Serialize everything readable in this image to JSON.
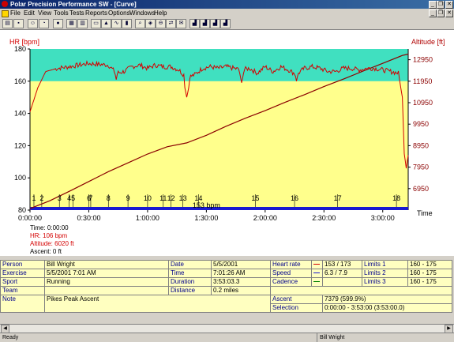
{
  "window": {
    "title": "Polar Precision Performance SW - [Curve]"
  },
  "menu": [
    "File",
    "Edit",
    "View",
    "Tools",
    "Tests",
    "Reports",
    "Options",
    "Windows",
    "Help"
  ],
  "chart_data": {
    "type": "line",
    "left_axis_label": "HR [bpm]",
    "right_axis_label": "Altitude [ft]",
    "x_axis_label": "Time",
    "hr_ticks": [
      "180",
      "160",
      "140",
      "120",
      "100",
      "80"
    ],
    "hr_ylim": [
      80,
      180
    ],
    "alt_ticks": [
      "12950",
      "11950",
      "10950",
      "9950",
      "8950",
      "7950",
      "6950"
    ],
    "alt_ylim": [
      5950,
      13450
    ],
    "time_ticks": [
      "0:00:00",
      "0:30:00",
      "1:00:00",
      "1:30:00",
      "2:00:00",
      "2:30:00",
      "3:00:00"
    ],
    "time_tick_seconds": [
      0,
      1800,
      3600,
      5400,
      7200,
      9000,
      10800
    ],
    "xlim_seconds": [
      0,
      11580
    ],
    "limits_band_bpm": [
      160,
      175
    ],
    "hr_series": {
      "name": "Heart rate",
      "color": "#d40000",
      "x_min": [
        0,
        4,
        8,
        14,
        20,
        30,
        40,
        44,
        48,
        52,
        56,
        60,
        64,
        68,
        72,
        76,
        80,
        84,
        88,
        92,
        96,
        100,
        104,
        108,
        112,
        116,
        120,
        124,
        128,
        132,
        136,
        140,
        144,
        148,
        152,
        156,
        160,
        164,
        168,
        172,
        176,
        180,
        184,
        188,
        190,
        191,
        192,
        193
      ],
      "bpm": [
        141,
        156,
        166,
        168,
        169,
        171,
        170,
        165,
        166,
        169,
        170,
        168,
        170,
        169,
        169,
        167,
        162,
        164,
        168,
        169,
        168,
        169,
        168,
        167,
        168,
        165,
        169,
        166,
        169,
        167,
        164,
        168,
        169,
        168,
        166,
        166,
        168,
        168,
        167,
        168,
        168,
        167,
        166,
        165,
        150,
        115,
        106,
        114
      ]
    },
    "dips": [
      {
        "x_min": 44,
        "bpm": 161
      },
      {
        "x_min": 80,
        "bpm": 150
      },
      {
        "x_min": 108,
        "bpm": 159
      },
      {
        "x_min": 136,
        "bpm": 160
      }
    ],
    "altitude_series": {
      "name": "Altitude",
      "color": "#8b0000",
      "x_min": [
        0,
        10,
        20,
        30,
        40,
        50,
        60,
        70,
        80,
        90,
        100,
        110,
        120,
        130,
        140,
        150,
        160,
        170,
        180,
        190,
        193
      ],
      "ft": [
        6020,
        6380,
        6820,
        7280,
        7740,
        8150,
        8560,
        8900,
        9080,
        9430,
        9850,
        10230,
        10580,
        10960,
        11320,
        11700,
        12050,
        12420,
        12780,
        13150,
        13210
      ]
    },
    "lap_markers": [
      "1",
      "2",
      "3",
      "4",
      "5",
      "6",
      "7",
      "8",
      "9",
      "10",
      "11",
      "12",
      "13",
      "14",
      "15",
      "16",
      "17",
      "18"
    ],
    "lap_marker_min": [
      2,
      6,
      15,
      20,
      22,
      30,
      31,
      40,
      50,
      60,
      68,
      72,
      78,
      86,
      115,
      135,
      157,
      187
    ],
    "avg_hr_label": "153 bpm",
    "cursor_readout": {
      "time": "Time: 0:00:00",
      "hr": "HR: 106 bpm",
      "altitude": "Altitude: 6020 ft",
      "ascent": "Ascent: 0 ft"
    },
    "colors": {
      "band": "#40e0c0",
      "background": "#ffff8c",
      "hr_line": "#d40000",
      "altitude_line": "#8b0000",
      "time_bar": "#1a1ad0"
    }
  },
  "info": {
    "person_label": "Person",
    "person_value": "Bill Wright",
    "exercise_label": "Exercise",
    "exercise_value": "5/5/2001 7:01 AM",
    "sport_label": "Sport",
    "sport_value": "Running",
    "team_label": "Team",
    "team_value": "",
    "note_label": "Note",
    "note_value": "Pikes Peak Ascent",
    "date_label": "Date",
    "date_value": "5/5/2001",
    "time_label": "Time",
    "time_value": "7:01:26 AM",
    "duration_label": "Duration",
    "duration_value": "3:53:03.3",
    "distance_label": "Distance",
    "distance_value": "0.2 miles",
    "hr_label": "Heart rate",
    "hr_value": "153 / 173",
    "speed_label": "Speed",
    "speed_value": "6.3 / 7.9",
    "cadence_label": "Cadence",
    "cadence_value": "",
    "ascent_label": "Ascent",
    "ascent_value": "7379 (599.9%)",
    "selection_label": "Selection",
    "selection_value": "0:00:00 - 3:53:00 (3:53:00.0)",
    "limits1_label": "Limits 1",
    "limits1_value": "160 - 175",
    "limits2_label": "Limits 2",
    "limits2_value": "160 - 175",
    "limits3_label": "Limits 3",
    "limits3_value": "160 - 175"
  },
  "status": {
    "left": "Ready",
    "right": "Bill Wright"
  }
}
